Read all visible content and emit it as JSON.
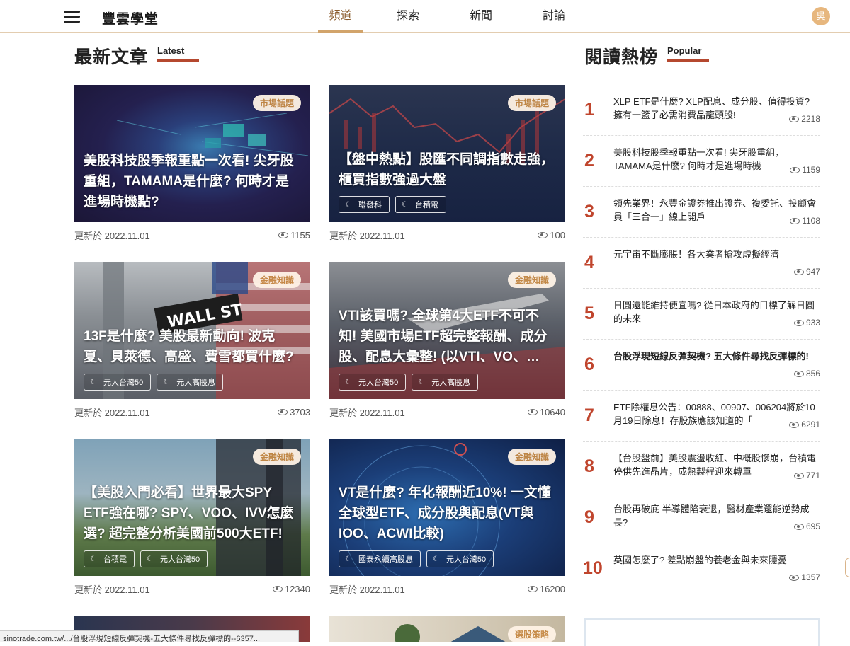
{
  "header": {
    "logo": "豐雲學堂",
    "tabs": [
      "頻道",
      "探索",
      "新聞",
      "討論"
    ],
    "active_tab": "頻道",
    "avatar": "吳"
  },
  "latest": {
    "title": "最新文章",
    "sub": "Latest"
  },
  "popular": {
    "title": "閱讀熱榜",
    "sub": "Popular"
  },
  "cards": [
    {
      "badge": "市場話題",
      "title": "美股科技股季報重點一次看! 尖牙股重組，TAMAMA是什麼? 何時才是進場時機點?",
      "tags": [],
      "date": "更新於 2022.11.01",
      "views": "1155"
    },
    {
      "badge": "市場話題",
      "title": "【盤中熱點】股匯不同調指數走強，櫃買指數強過大盤",
      "tags": [
        "聯發科",
        "台積電"
      ],
      "date": "更新於 2022.11.01",
      "views": "100"
    },
    {
      "badge": "金融知識",
      "title": "13F是什麼? 美股最新動向! 波克夏、貝萊德、高盛、費雪都買什麼?",
      "tags": [
        "元大台灣50",
        "元大高股息"
      ],
      "date": "更新於 2022.11.01",
      "views": "3703"
    },
    {
      "badge": "金融知識",
      "title": "VTI該買嗎? 全球第4大ETF不可不知! 美國市場ETF超完整報酬、成分股、配息大彙整! (以VTI、VO、…",
      "tags": [
        "元大台灣50",
        "元大高股息"
      ],
      "date": "更新於 2022.11.01",
      "views": "10640"
    },
    {
      "badge": "金融知識",
      "title": "【美股入門必看】世界最大SPY ETF強在哪? SPY、VOO、IVV怎麼選? 超完整分析美國前500大ETF!",
      "tags": [
        "台積電",
        "元大台灣50"
      ],
      "date": "更新於 2022.11.01",
      "views": "12340"
    },
    {
      "badge": "金融知識",
      "title": "VT是什麼? 年化報酬近10%! 一文懂全球型ETF、成分股與配息(VT與IOO、ACWI比較)",
      "tags": [
        "國泰永續高股息",
        "元大台灣50"
      ],
      "date": "更新於 2022.11.01",
      "views": "16200"
    },
    {
      "badge": "選股策略",
      "title": "",
      "tags": [],
      "date": "",
      "views": ""
    }
  ],
  "popular_list": [
    {
      "rank": "1",
      "title": "XLP ETF是什麼? XLP配息、成分股、值得投資? 擁有一籃子必需消費品龍頭股!",
      "views": "2218"
    },
    {
      "rank": "2",
      "title": "美股科技股季報重點一次看! 尖牙股重組，TAMAMA是什麼? 何時才是進場時機",
      "views": "1159"
    },
    {
      "rank": "3",
      "title": "領先業界！永豐金證券推出證券、複委託、投顧會員「三合一」線上開戶",
      "views": "1108"
    },
    {
      "rank": "4",
      "title": "元宇宙不斷膨脹！各大業者搶攻虛擬經濟",
      "views": "947"
    },
    {
      "rank": "5",
      "title": "日圓還能維持便宜嗎? 從日本政府的目標了解日圓的未來",
      "views": "933"
    },
    {
      "rank": "6",
      "title": "台股浮現短線反彈契機? 五大條件尋找反彈標的!",
      "views": "856"
    },
    {
      "rank": "7",
      "title": "ETF除權息公告：00888、00907、006204將於10月19日除息！存股族應該知道的「",
      "views": "6291"
    },
    {
      "rank": "8",
      "title": "【台股盤前】美股震盪收紅、中概股慘崩，台積電停供先進晶片，成熟製程迎來轉單",
      "views": "771"
    },
    {
      "rank": "9",
      "title": "台股再破底 半導體陷衰退，醫材產業還能逆勢成長?",
      "views": "695"
    },
    {
      "rank": "10",
      "title": "英國怎麼了? 差點崩盤的養老金與未來隱憂",
      "views": "1357"
    }
  ],
  "statusbar": "sinotrade.com.tw/.../台股浮現短線反彈契機-五大條件尋找反彈標的--6357...",
  "colors": {
    "accent": "#b5482f",
    "gold": "#d2a46b",
    "badge_text": "#c78a45"
  }
}
